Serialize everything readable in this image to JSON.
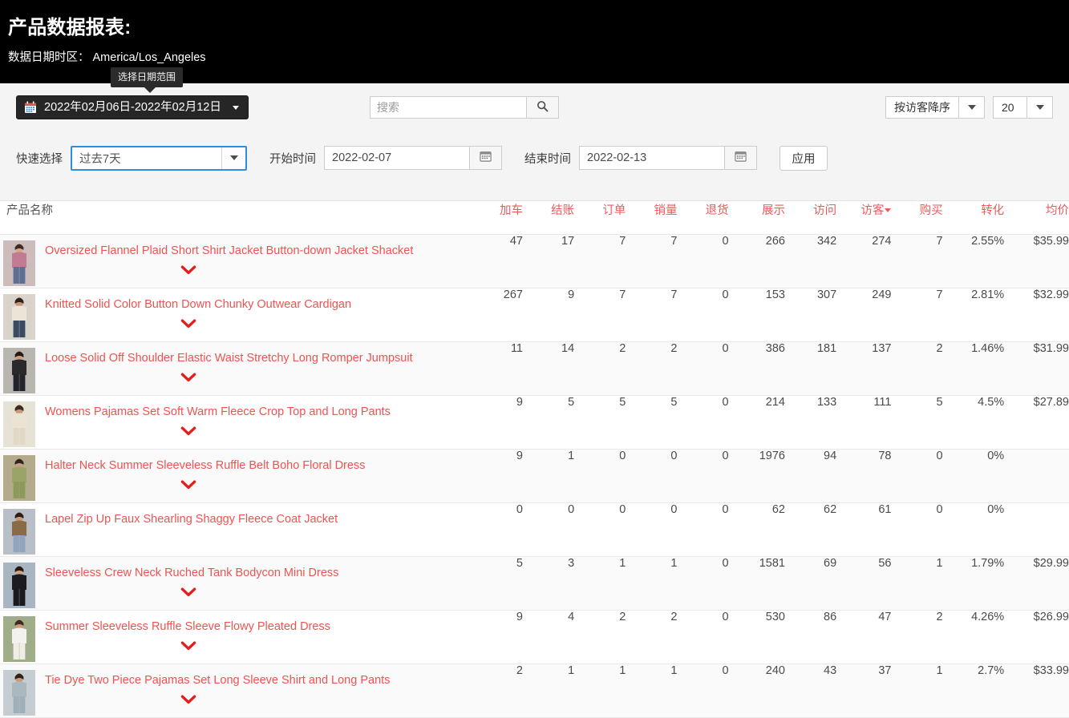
{
  "header": {
    "title": "产品数据报表:",
    "timezone_label": "数据日期时区：",
    "timezone_value": "America/Los_Angeles",
    "tooltip": "选择日期范围"
  },
  "toolbar": {
    "date_range_value": "2022年02月06日-2022年02月12日",
    "calendar_icon": "calendar-icon",
    "search_placeholder": "搜索",
    "search_value": "",
    "search_icon": "search-icon",
    "sort_value": "按访客降序",
    "page_size_value": "20"
  },
  "filters": {
    "quick_label": "快速选择",
    "quick_value": "过去7天",
    "start_label": "开始时间",
    "start_value": "2022-02-07",
    "end_label": "结束时间",
    "end_value": "2022-02-13",
    "apply_label": "应用"
  },
  "table": {
    "columns": [
      {
        "key": "name",
        "label": "产品名称"
      },
      {
        "key": "add_to_cart",
        "label": "加车"
      },
      {
        "key": "checkout",
        "label": "结账"
      },
      {
        "key": "orders",
        "label": "订单"
      },
      {
        "key": "sales",
        "label": "销量"
      },
      {
        "key": "returns",
        "label": "退货"
      },
      {
        "key": "impressions",
        "label": "展示"
      },
      {
        "key": "visits",
        "label": "访问"
      },
      {
        "key": "visitors",
        "label": "访客",
        "sorted": "desc"
      },
      {
        "key": "purchases",
        "label": "购买"
      },
      {
        "key": "conversion",
        "label": "转化"
      },
      {
        "key": "avg_price",
        "label": "均价"
      }
    ],
    "rows": [
      {
        "name": "Oversized Flannel Plaid Short Shirt Jacket Button-down Jacket Shacket",
        "expandable": true,
        "add_to_cart": "47",
        "checkout": "17",
        "orders": "7",
        "sales": "7",
        "returns": "0",
        "impressions": "266",
        "visits": "342",
        "visitors": "274",
        "purchases": "7",
        "conversion": "2.55%",
        "avg_price": "$35.99"
      },
      {
        "name": "Knitted Solid Color Button Down Chunky Outwear Cardigan",
        "expandable": true,
        "add_to_cart": "267",
        "checkout": "9",
        "orders": "7",
        "sales": "7",
        "returns": "0",
        "impressions": "153",
        "visits": "307",
        "visitors": "249",
        "purchases": "7",
        "conversion": "2.81%",
        "avg_price": "$32.99"
      },
      {
        "name": "Loose Solid Off Shoulder Elastic Waist Stretchy Long Romper Jumpsuit",
        "expandable": true,
        "add_to_cart": "11",
        "checkout": "14",
        "orders": "2",
        "sales": "2",
        "returns": "0",
        "impressions": "386",
        "visits": "181",
        "visitors": "137",
        "purchases": "2",
        "conversion": "1.46%",
        "avg_price": "$31.99"
      },
      {
        "name": "Womens Pajamas Set Soft Warm Fleece Crop Top and Long Pants",
        "expandable": true,
        "add_to_cart": "9",
        "checkout": "5",
        "orders": "5",
        "sales": "5",
        "returns": "0",
        "impressions": "214",
        "visits": "133",
        "visitors": "111",
        "purchases": "5",
        "conversion": "4.5%",
        "avg_price": "$27.89"
      },
      {
        "name": "Halter Neck Summer Sleeveless Ruffle Belt Boho Floral Dress",
        "expandable": true,
        "add_to_cart": "9",
        "checkout": "1",
        "orders": "0",
        "sales": "0",
        "returns": "0",
        "impressions": "1976",
        "visits": "94",
        "visitors": "78",
        "purchases": "0",
        "conversion": "0%",
        "avg_price": ""
      },
      {
        "name": "Lapel Zip Up Faux Shearling Shaggy Fleece Coat Jacket",
        "expandable": false,
        "add_to_cart": "0",
        "checkout": "0",
        "orders": "0",
        "sales": "0",
        "returns": "0",
        "impressions": "62",
        "visits": "62",
        "visitors": "61",
        "purchases": "0",
        "conversion": "0%",
        "avg_price": ""
      },
      {
        "name": "Sleeveless Crew Neck Ruched Tank Bodycon Mini Dress",
        "expandable": true,
        "add_to_cart": "5",
        "checkout": "3",
        "orders": "1",
        "sales": "1",
        "returns": "0",
        "impressions": "1581",
        "visits": "69",
        "visitors": "56",
        "purchases": "1",
        "conversion": "1.79%",
        "avg_price": "$29.99"
      },
      {
        "name": "Summer Sleeveless Ruffle Sleeve Flowy Pleated Dress",
        "expandable": true,
        "add_to_cart": "9",
        "checkout": "4",
        "orders": "2",
        "sales": "2",
        "returns": "0",
        "impressions": "530",
        "visits": "86",
        "visitors": "47",
        "purchases": "2",
        "conversion": "4.26%",
        "avg_price": "$26.99"
      },
      {
        "name": "Tie Dye Two Piece Pajamas Set Long Sleeve Shirt and Long Pants",
        "expandable": true,
        "add_to_cart": "2",
        "checkout": "1",
        "orders": "1",
        "sales": "1",
        "returns": "0",
        "impressions": "240",
        "visits": "43",
        "visitors": "37",
        "purchases": "1",
        "conversion": "2.7%",
        "avg_price": "$33.99"
      }
    ]
  },
  "colors": {
    "accent_red": "#ef5350",
    "header_bg": "#000000",
    "toolbar_bg": "#f4f4f4",
    "focus_blue": "#2a8fe0"
  }
}
